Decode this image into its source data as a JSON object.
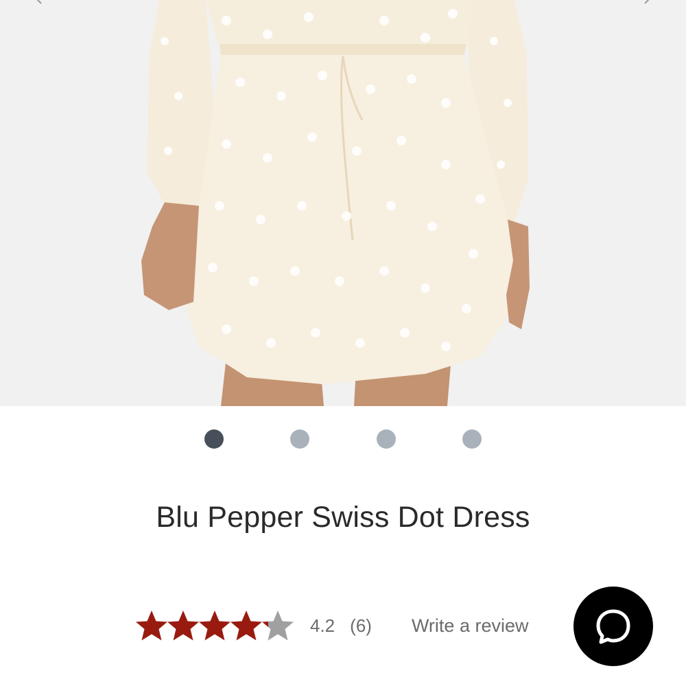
{
  "gallery": {
    "alt": "Cream swiss dot chiffon dress with drawstring waist and long balloon sleeves",
    "slides": [
      {
        "active": true,
        "color": "#47505a"
      },
      {
        "active": false,
        "color": "#a9b2bb"
      },
      {
        "active": false,
        "color": "#a9b2bb"
      },
      {
        "active": false,
        "color": "#a9b2bb"
      }
    ]
  },
  "product": {
    "title": "Blu Pepper Swiss Dot Dress"
  },
  "rating": {
    "value": 4.2,
    "max": 5,
    "score_text": "4.2",
    "count_text": "(6)",
    "filled_color": "#991b10",
    "empty_color": "#a0a0a0",
    "write_review_label": "Write a review"
  },
  "chat": {
    "icon": "chat-bubble-icon",
    "background": "#000000"
  }
}
